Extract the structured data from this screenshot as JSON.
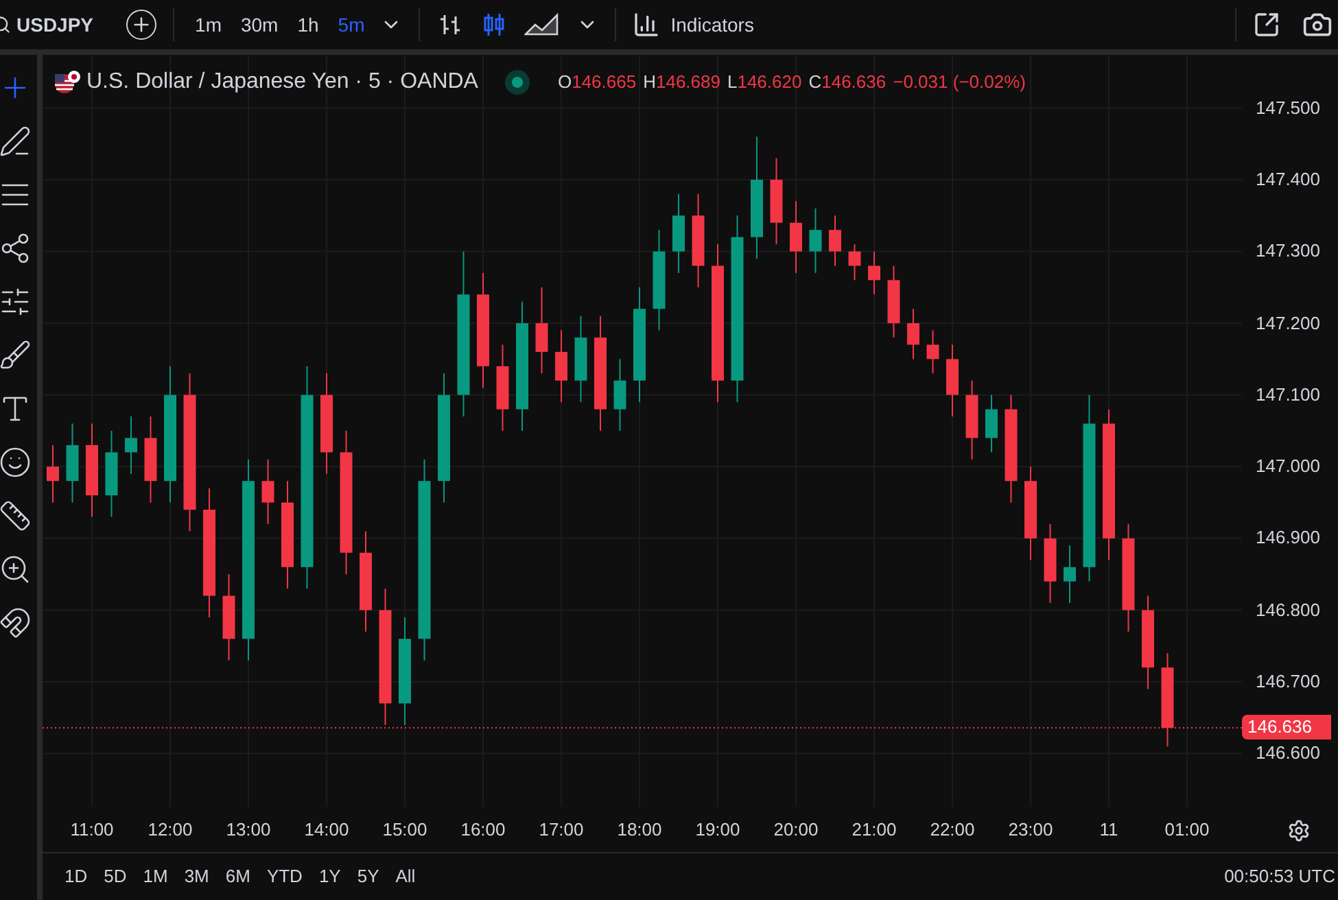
{
  "toolbar": {
    "symbol": "USDJPY",
    "intervals": [
      {
        "label": "1m",
        "selected": false
      },
      {
        "label": "30m",
        "selected": false
      },
      {
        "label": "1h",
        "selected": false
      },
      {
        "label": "5m",
        "selected": true
      }
    ],
    "chart_styles": [
      {
        "kind": "bars",
        "selected": false
      },
      {
        "kind": "candles",
        "selected": true
      },
      {
        "kind": "area",
        "selected": false
      }
    ],
    "indicators_label": "Indicators"
  },
  "drawing_tools": [
    {
      "kind": "crosshair",
      "selected": true
    },
    {
      "kind": "trendline",
      "selected": false
    },
    {
      "kind": "fib",
      "selected": false
    },
    {
      "kind": "pattern",
      "selected": false
    },
    {
      "kind": "projection",
      "selected": false
    },
    {
      "kind": "brush",
      "selected": false
    },
    {
      "kind": "text",
      "selected": false
    },
    {
      "kind": "emoji",
      "selected": false
    },
    {
      "kind": "ruler",
      "selected": false
    },
    {
      "kind": "zoom",
      "selected": false
    },
    {
      "kind": "magnet",
      "selected": false
    }
  ],
  "legend": {
    "title": "U.S. Dollar / Japanese Yen · 5 · OANDA",
    "market_open": true,
    "ohlc": [
      {
        "key": "O",
        "value": "146.665"
      },
      {
        "key": "H",
        "value": "146.689"
      },
      {
        "key": "L",
        "value": "146.620"
      },
      {
        "key": "C",
        "value": "146.636"
      }
    ],
    "change": "−0.031 (−0.02%)"
  },
  "chart": {
    "chart_data": {
      "type": "candlestick",
      "ylim": [
        146.526,
        147.574
      ],
      "grid": true,
      "ref_lines": [
        {
          "axis": "y",
          "value": 146.636,
          "label": "146.636",
          "color": "#f23645"
        }
      ],
      "yticks": [
        {
          "value": 147.5,
          "label": "147.500"
        },
        {
          "value": 147.4,
          "label": "147.400"
        },
        {
          "value": 147.3,
          "label": "147.300"
        },
        {
          "value": 147.2,
          "label": "147.200"
        },
        {
          "value": 147.1,
          "label": "147.100"
        },
        {
          "value": 147.0,
          "label": "147.000"
        },
        {
          "value": 146.9,
          "label": "146.900"
        },
        {
          "value": 146.8,
          "label": "146.800"
        },
        {
          "value": 146.7,
          "label": "146.700"
        },
        {
          "value": 146.6,
          "label": "146.600"
        }
      ],
      "categories": [
        null,
        null,
        "11:00",
        null,
        null,
        null,
        "12:00",
        null,
        null,
        null,
        "13:00",
        null,
        null,
        null,
        "14:00",
        null,
        null,
        null,
        "15:00",
        null,
        null,
        null,
        "16:00",
        null,
        null,
        null,
        "17:00",
        null,
        null,
        null,
        "18:00",
        null,
        null,
        null,
        "19:00",
        null,
        null,
        null,
        "20:00",
        null,
        null,
        null,
        "21:00",
        null,
        null,
        null,
        "22:00",
        null,
        null,
        null,
        "23:00",
        null,
        null,
        null,
        "11",
        null,
        null,
        null,
        "01:00"
      ],
      "ohlc": [
        [
          147.0,
          147.03,
          146.95,
          146.98
        ],
        [
          146.98,
          147.06,
          146.95,
          147.03
        ],
        [
          147.03,
          147.06,
          146.93,
          146.96
        ],
        [
          146.96,
          147.05,
          146.93,
          147.02
        ],
        [
          147.02,
          147.07,
          146.99,
          147.04
        ],
        [
          147.04,
          147.07,
          146.95,
          146.98
        ],
        [
          146.98,
          147.14,
          146.95,
          147.1
        ],
        [
          147.1,
          147.13,
          146.91,
          146.94
        ],
        [
          146.94,
          146.97,
          146.79,
          146.82
        ],
        [
          146.82,
          146.85,
          146.73,
          146.76
        ],
        [
          146.76,
          147.01,
          146.73,
          146.98
        ],
        [
          146.98,
          147.01,
          146.92,
          146.95
        ],
        [
          146.95,
          146.98,
          146.83,
          146.86
        ],
        [
          146.86,
          147.14,
          146.83,
          147.1
        ],
        [
          147.1,
          147.13,
          146.99,
          147.02
        ],
        [
          147.02,
          147.05,
          146.85,
          146.88
        ],
        [
          146.88,
          146.91,
          146.77,
          146.8
        ],
        [
          146.8,
          146.83,
          146.64,
          146.67
        ],
        [
          146.67,
          146.79,
          146.64,
          146.76
        ],
        [
          146.76,
          147.01,
          146.73,
          146.98
        ],
        [
          146.98,
          147.13,
          146.95,
          147.1
        ],
        [
          147.1,
          147.3,
          147.07,
          147.24
        ],
        [
          147.24,
          147.27,
          147.11,
          147.14
        ],
        [
          147.14,
          147.17,
          147.05,
          147.08
        ],
        [
          147.08,
          147.23,
          147.05,
          147.2
        ],
        [
          147.2,
          147.25,
          147.13,
          147.16
        ],
        [
          147.16,
          147.19,
          147.09,
          147.12
        ],
        [
          147.12,
          147.21,
          147.09,
          147.18
        ],
        [
          147.18,
          147.21,
          147.05,
          147.08
        ],
        [
          147.08,
          147.15,
          147.05,
          147.12
        ],
        [
          147.12,
          147.25,
          147.09,
          147.22
        ],
        [
          147.22,
          147.33,
          147.19,
          147.3
        ],
        [
          147.3,
          147.38,
          147.27,
          147.35
        ],
        [
          147.35,
          147.38,
          147.25,
          147.28
        ],
        [
          147.28,
          147.31,
          147.09,
          147.12
        ],
        [
          147.12,
          147.35,
          147.09,
          147.32
        ],
        [
          147.32,
          147.46,
          147.29,
          147.4
        ],
        [
          147.4,
          147.43,
          147.31,
          147.34
        ],
        [
          147.34,
          147.37,
          147.27,
          147.3
        ],
        [
          147.3,
          147.36,
          147.27,
          147.33
        ],
        [
          147.33,
          147.35,
          147.28,
          147.3
        ],
        [
          147.3,
          147.31,
          147.26,
          147.28
        ],
        [
          147.28,
          147.3,
          147.24,
          147.26
        ],
        [
          147.26,
          147.28,
          147.18,
          147.2
        ],
        [
          147.2,
          147.22,
          147.15,
          147.17
        ],
        [
          147.17,
          147.19,
          147.13,
          147.15
        ],
        [
          147.15,
          147.17,
          147.07,
          147.1
        ],
        [
          147.1,
          147.12,
          147.01,
          147.04
        ],
        [
          147.04,
          147.1,
          147.02,
          147.08
        ],
        [
          147.08,
          147.1,
          146.95,
          146.98
        ],
        [
          146.98,
          147.0,
          146.87,
          146.9
        ],
        [
          146.9,
          146.92,
          146.81,
          146.84
        ],
        [
          146.84,
          146.89,
          146.81,
          146.86
        ],
        [
          146.86,
          147.1,
          146.84,
          147.06
        ],
        [
          147.06,
          147.08,
          146.87,
          146.9
        ],
        [
          146.9,
          146.92,
          146.77,
          146.8
        ],
        [
          146.8,
          146.82,
          146.69,
          146.72
        ],
        [
          146.72,
          146.74,
          146.61,
          146.636
        ],
        null
      ]
    }
  },
  "ranges": [
    "1D",
    "5D",
    "1M",
    "3M",
    "6M",
    "YTD",
    "1Y",
    "5Y",
    "All"
  ],
  "clock": "00:50:53 UTC"
}
